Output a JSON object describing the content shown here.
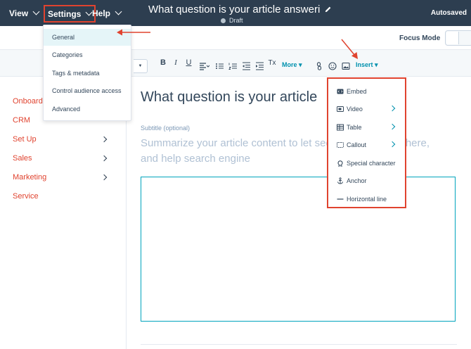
{
  "topbar": {
    "view_label": "View",
    "settings_label": "Settings",
    "help_label": "Help",
    "article_title": "What question is your article answeri",
    "status": "Draft",
    "save_status": "Autosaved"
  },
  "header2": {
    "focus_mode_label": "Focus Mode"
  },
  "toolbar": {
    "bold": "B",
    "italic": "I",
    "underline": "U",
    "more_label": "More ▾",
    "insert_label": "Insert ▾",
    "clear_format": "Tx"
  },
  "settings_menu": {
    "items": [
      {
        "label": "General",
        "active": true
      },
      {
        "label": "Categories"
      },
      {
        "label": "Tags & metadata"
      },
      {
        "label": "Control audience access"
      },
      {
        "label": "Advanced"
      }
    ]
  },
  "leftnav": {
    "items": [
      {
        "label": "Onboardi"
      },
      {
        "label": "CRM"
      },
      {
        "label": "Set Up"
      },
      {
        "label": "Sales"
      },
      {
        "label": "Marketing"
      },
      {
        "label": "Service"
      }
    ]
  },
  "main": {
    "heading": "What question is your article",
    "subtitle_label": "Subtitle (optional)",
    "summary_placeholder": "Summarize your article content to let see their answer is here, and help search engine"
  },
  "insert_menu": {
    "items": [
      {
        "label": "Embed",
        "icon": "embed-icon"
      },
      {
        "label": "Video",
        "icon": "video-icon",
        "submenu": true
      },
      {
        "label": "Table",
        "icon": "table-icon",
        "submenu": true
      },
      {
        "label": "Callout",
        "icon": "callout-icon",
        "submenu": true
      },
      {
        "label": "Special character",
        "icon": "omega-icon"
      },
      {
        "label": "Anchor",
        "icon": "anchor-icon"
      },
      {
        "label": "Horizontal line",
        "icon": "horizontal-line-icon"
      }
    ]
  },
  "colors": {
    "topbar": "#2d3e50",
    "accent": "#0091ae",
    "highlight": "#e0432f",
    "editor_border": "#00a4bd"
  }
}
